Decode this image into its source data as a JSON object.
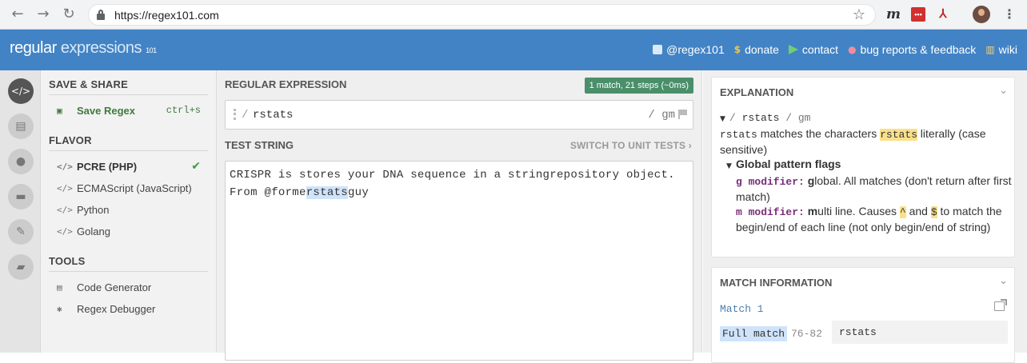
{
  "browser": {
    "url": "https://regex101.com",
    "ext_m": "m",
    "ext_red": "•••",
    "ext_pdf": "⅄"
  },
  "header": {
    "logo_main": "regular",
    "logo_thin": " expressions",
    "logo_sub": "101",
    "links": {
      "twitter": "@regex101",
      "donate": "donate",
      "contact": "contact",
      "bug": "bug reports & feedback",
      "wiki": "wiki"
    }
  },
  "sidebar": {
    "save_title": "SAVE & SHARE",
    "save_label": "Save Regex",
    "save_shortcut": "ctrl+s",
    "flavor_title": "FLAVOR",
    "flavors": [
      "PCRE (PHP)",
      "ECMAScript (JavaScript)",
      "Python",
      "Golang"
    ],
    "selected_flavor": "PCRE (PHP)",
    "tools_title": "TOOLS",
    "tools": [
      "Code Generator",
      "Regex Debugger"
    ]
  },
  "main": {
    "regex_title": "REGULAR EXPRESSION",
    "status_badge": "1 match, 21 steps (~0ms)",
    "delim_open": "/",
    "pattern": "rstats",
    "flags": "/ gm",
    "test_title": "TEST STRING",
    "switch_label": "SWITCH TO UNIT TESTS ›",
    "test_line1": "CRISPR is stores your DNA sequence in a stringrepository object.",
    "test_line2_pre": "From @forme",
    "test_line2_match": "rstats",
    "test_line2_post": "guy"
  },
  "explanation": {
    "title": "EXPLANATION",
    "regex_line_open": "/ ",
    "regex_line_pattern": "rstats",
    "regex_line_flags": " / gm",
    "desc_token": "rstats",
    "desc_text1": " matches the characters ",
    "desc_literal": "rstats",
    "desc_text2": " literally (case sensitive)",
    "flags_title": "Global pattern flags",
    "g_mod": "g modifier:",
    "g_bold": "g",
    "g_text": "lobal. All matches (don't return after first match)",
    "m_mod": "m modifier:",
    "m_bold": "m",
    "m_text1": "ulti line. Causes ",
    "caret": "^",
    "m_and": " and ",
    "dollar": "$",
    "m_text2": " to match the begin/end of each line (not only begin/end of string)"
  },
  "match_info": {
    "title": "MATCH INFORMATION",
    "match_label": "Match 1",
    "full_match": "Full match",
    "range": "76-82",
    "value": "rstats"
  },
  "colors": {
    "header_blue": "#4283c5",
    "badge_green": "#4a8f6a",
    "match_highlight": "#cfe3fa",
    "literal_yellow": "#fae08a"
  }
}
